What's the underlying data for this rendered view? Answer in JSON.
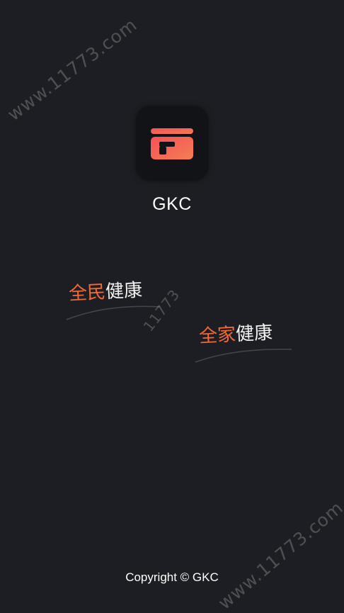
{
  "app": {
    "name": "GKC",
    "icon": "gkc-logo-icon",
    "colors": {
      "background": "#1d1e23",
      "icon_tile": "#121316",
      "logo_gradient_start": "#f6505a",
      "logo_gradient_end": "#f47e52",
      "accent": "#ee6a3a",
      "text": "#ffffff"
    }
  },
  "slogans": [
    {
      "accent_text": "全民",
      "plain_text": "健康"
    },
    {
      "accent_text": "全家",
      "plain_text": "健康"
    }
  ],
  "watermarks": [
    "www.11773.com",
    "11773",
    "www.11773.com"
  ],
  "footer": {
    "copyright": "Copyright © GKC"
  }
}
